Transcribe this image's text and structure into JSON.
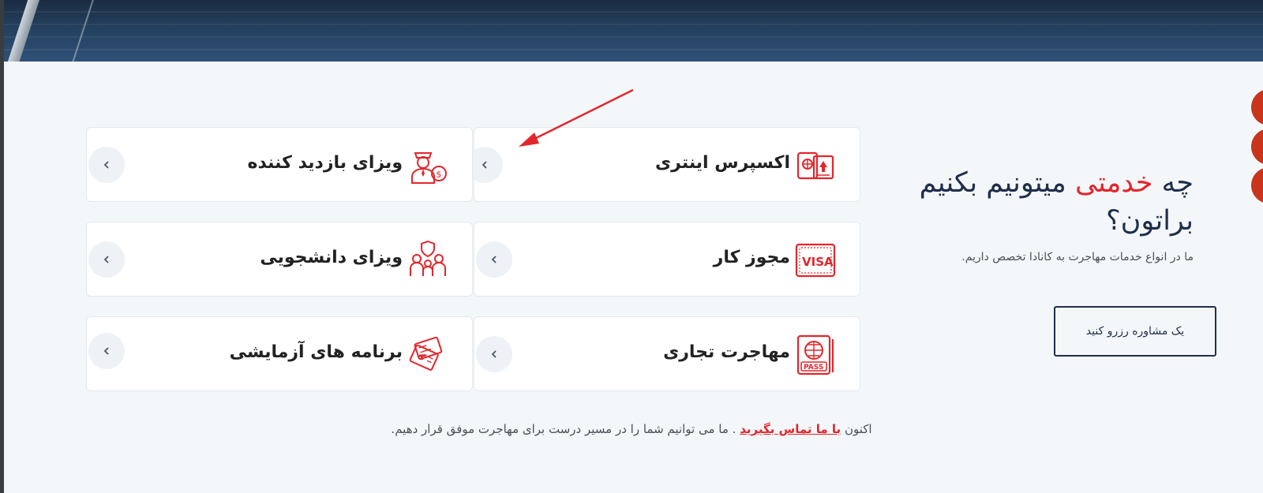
{
  "section": {
    "title_prefix": "چه",
    "title_accent": "خدمتی",
    "title_suffix": "میتونیم بکنیم براتون؟",
    "subtitle": "ما در انواع خدمات مهاجرت به کانادا تخصص داریم.",
    "cta_label": "یک مشاوره رزرو کنید"
  },
  "services": [
    {
      "label": "اکسپرس اینتری",
      "icon": "passport-icon"
    },
    {
      "label": "ویزای بازدید کننده",
      "icon": "visitor-icon"
    },
    {
      "label": "مجوز کار",
      "icon": "visa-card-icon"
    },
    {
      "label": "ویزای دانشجویی",
      "icon": "family-shield-icon"
    },
    {
      "label": "مهاجرت تجاری",
      "icon": "pass-book-icon"
    },
    {
      "label": "برنامه های آزمایشی",
      "icon": "tickets-icon"
    }
  ],
  "footer": {
    "prefix": "اکنون",
    "link_label": "با ما تماس بگیرید",
    "suffix": ". ما می توانیم شما را در مسیر درست برای مهاجرت موفق قرار دهیم."
  },
  "colors": {
    "accent": "#e3262c",
    "navy": "#1f2e4a",
    "badge": "#c8351c",
    "background": "#f4f7fa"
  }
}
